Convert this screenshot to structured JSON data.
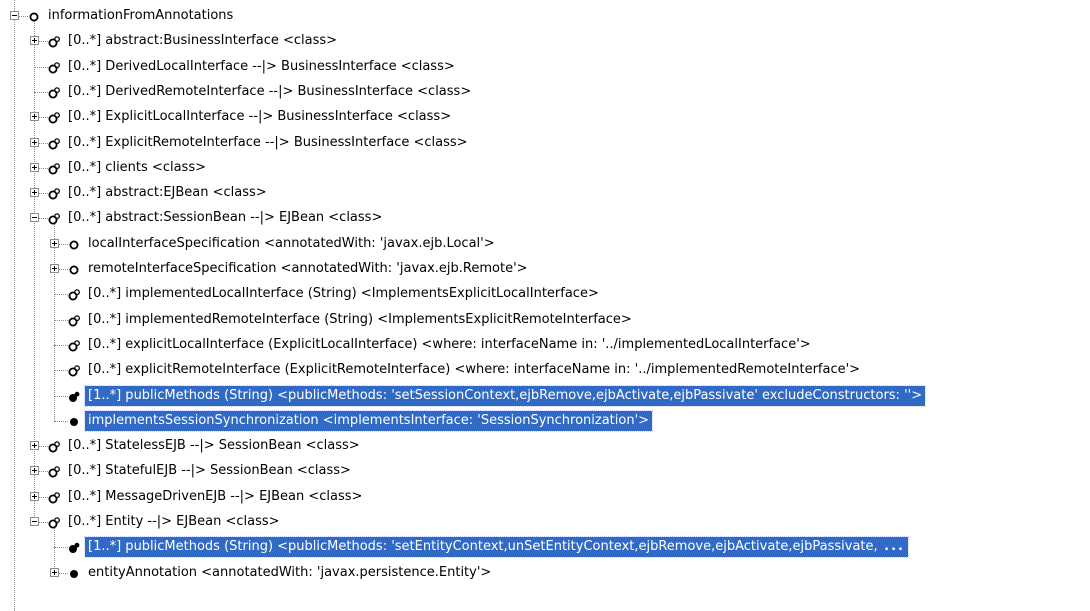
{
  "tree": {
    "nodes": [
      {
        "depth": 0,
        "expander": "minus",
        "icon": "circle-node-icon",
        "label": "informationFromAnnotations",
        "selected": false
      },
      {
        "depth": 1,
        "expander": "plus",
        "icon": "multi-node-icon",
        "label": "[0..*] abstract:BusinessInterface <class>",
        "selected": false
      },
      {
        "depth": 1,
        "expander": "none",
        "icon": "multi-node-icon",
        "label": "[0..*] DerivedLocalInterface --|> BusinessInterface <class>",
        "selected": false
      },
      {
        "depth": 1,
        "expander": "none",
        "icon": "multi-node-icon",
        "label": "[0..*] DerivedRemoteInterface --|> BusinessInterface <class>",
        "selected": false
      },
      {
        "depth": 1,
        "expander": "plus",
        "icon": "multi-node-icon",
        "label": "[0..*] ExplicitLocalInterface --|> BusinessInterface <class>",
        "selected": false
      },
      {
        "depth": 1,
        "expander": "plus",
        "icon": "multi-node-icon",
        "label": "[0..*] ExplicitRemoteInterface --|> BusinessInterface <class>",
        "selected": false
      },
      {
        "depth": 1,
        "expander": "plus",
        "icon": "multi-node-icon",
        "label": "[0..*] clients <class>",
        "selected": false
      },
      {
        "depth": 1,
        "expander": "plus",
        "icon": "multi-node-icon",
        "label": "[0..*] abstract:EJBean <class>",
        "selected": false
      },
      {
        "depth": 1,
        "expander": "minus",
        "icon": "multi-node-icon",
        "label": "[0..*] abstract:SessionBean --|> EJBean <class>",
        "selected": false
      },
      {
        "depth": 2,
        "expander": "plus",
        "icon": "circle-node-icon",
        "label": "localInterfaceSpecification <annotatedWith: 'javax.ejb.Local'>",
        "selected": false
      },
      {
        "depth": 2,
        "expander": "plus",
        "icon": "circle-node-icon",
        "label": "remoteInterfaceSpecification <annotatedWith: 'javax.ejb.Remote'>",
        "selected": false
      },
      {
        "depth": 2,
        "expander": "none",
        "icon": "multi-node-icon",
        "label": "[0..*] implementedLocalInterface (String) <ImplementsExplicitLocalInterface>",
        "selected": false
      },
      {
        "depth": 2,
        "expander": "none",
        "icon": "multi-node-icon",
        "label": "[0..*] implementedRemoteInterface (String) <ImplementsExplicitRemoteInterface>",
        "selected": false
      },
      {
        "depth": 2,
        "expander": "none",
        "icon": "multi-node-icon",
        "label": "[0..*] explicitLocalInterface (ExplicitLocalInterface) <where: interfaceName in: '../implementedLocalInterface'>",
        "selected": false
      },
      {
        "depth": 2,
        "expander": "none",
        "icon": "multi-node-icon",
        "label": "[0..*] explicitRemoteInterface (ExplicitRemoteInterface) <where: interfaceName in: '../implementedRemoteInterface'>",
        "selected": false
      },
      {
        "depth": 2,
        "expander": "none",
        "icon": "multi-filled-node-icon",
        "label": "[1..*] publicMethods (String) <publicMethods: 'setSessionContext,ejbRemove,ejbActivate,ejbPassivate' excludeConstructors: ''>",
        "selected": true
      },
      {
        "depth": 2,
        "expander": "none",
        "icon": "filled-node-icon",
        "label": "implementsSessionSynchronization <implementsInterface: 'SessionSynchronization'>",
        "selected": true
      },
      {
        "depth": 1,
        "expander": "plus",
        "icon": "multi-node-icon",
        "label": "[0..*] StatelessEJB --|> SessionBean <class>",
        "selected": false
      },
      {
        "depth": 1,
        "expander": "plus",
        "icon": "multi-node-icon",
        "label": "[0..*] StatefulEJB --|> SessionBean <class>",
        "selected": false
      },
      {
        "depth": 1,
        "expander": "plus",
        "icon": "multi-node-icon",
        "label": "[0..*] MessageDrivenEJB --|> EJBean <class>",
        "selected": false
      },
      {
        "depth": 1,
        "expander": "minus",
        "icon": "multi-node-icon",
        "label": "[0..*] Entity --|> EJBean <class>",
        "selected": false
      },
      {
        "depth": 2,
        "expander": "none",
        "icon": "multi-filled-node-icon",
        "label": "[1..*] publicMethods (String) <publicMethods: 'setEntityContext,unSetEntityContext,ejbRemove,ejbActivate,ejbPassivate,",
        "selected": true,
        "truncated": true
      },
      {
        "depth": 2,
        "expander": "plus",
        "icon": "filled-node-icon",
        "label": "entityAnnotation <annotatedWith: 'javax.persistence.Entity'>",
        "selected": false
      }
    ],
    "ellipsis_text": "...",
    "colors": {
      "selection_background": "#316ac5",
      "selection_text": "#ffffff",
      "tree_lines": "#8a8a8a"
    }
  }
}
